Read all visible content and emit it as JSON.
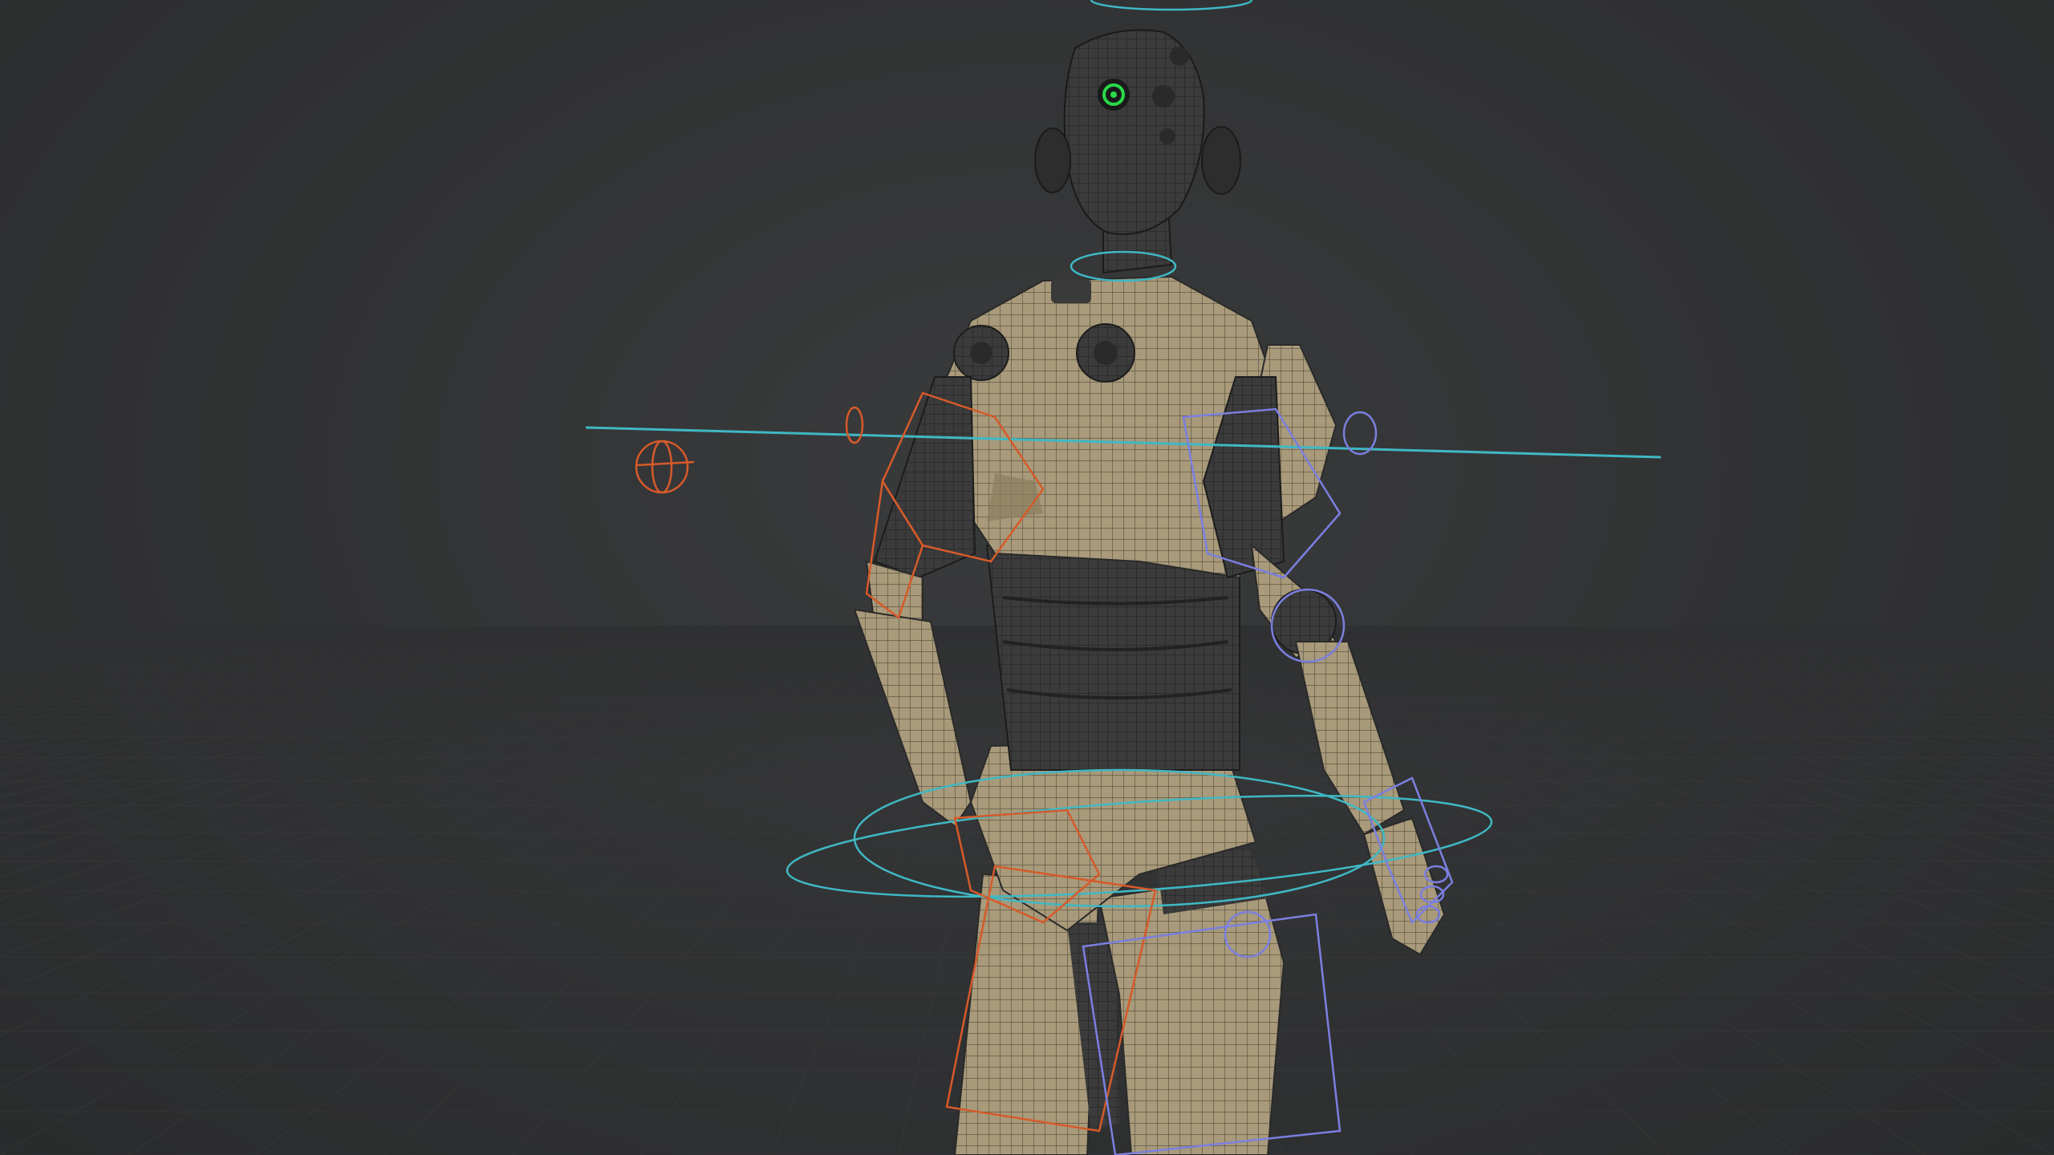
{
  "viewport": {
    "background": "#323334",
    "grid_color": "#3c3d3e",
    "mesh_base_color": "#a89a7a",
    "mesh_dark_color": "#3a3a3a",
    "wire_color": "#2a2a22",
    "eye_color": "#29d94a",
    "control_colors": {
      "center": "#3fb8c4",
      "left": "#d65a2a",
      "right": "#7b7fe0"
    },
    "icons": {
      "head_eye": "eye-icon",
      "shoulder_gizmo": "rotate-gizmo-icon"
    }
  }
}
